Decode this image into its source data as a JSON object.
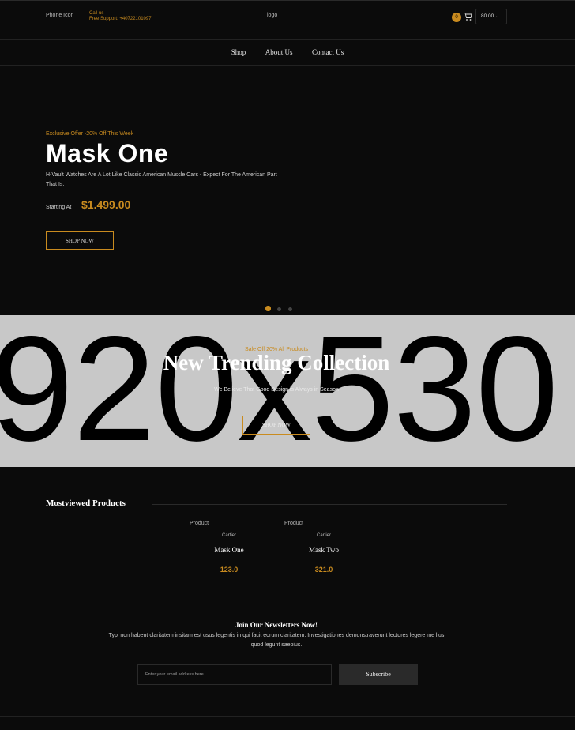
{
  "header": {
    "phone_icon_alt": "Phone Icon",
    "call_us": "Call us",
    "free_support": "Free Support: +40722101097",
    "logo_alt": "logo",
    "cart_count": "0",
    "cart_total": "80.00",
    "accent_color": "#c98b1f"
  },
  "nav": {
    "items": [
      {
        "label": "Shop"
      },
      {
        "label": "About Us"
      },
      {
        "label": "Contact Us"
      }
    ]
  },
  "hero": {
    "offer": "Exclusive Offer -20% Off This Week",
    "title": "Mask One",
    "description": "H-Vault Watches Are A Lot Like Classic American Muscle Cars - Expect For The American Part That Is.",
    "starting_label": "Starting At",
    "price": "$1.499.00",
    "button": "SHOP NOW",
    "slide_count": 3,
    "active_slide": 1
  },
  "banner": {
    "placeholder_text": "920x530",
    "sale": "Sale Off 20% All Products",
    "title": "New Trending Collection",
    "description": "We Believe That Good Design is Always in Season",
    "button": "SHOP NOW"
  },
  "products": {
    "title": "Mostviewed Products",
    "items": [
      {
        "image_alt": "Product",
        "brand": "Cartier",
        "name": "Mask One",
        "price": "123.0"
      },
      {
        "image_alt": "Product",
        "brand": "Cartier",
        "name": "Mask Two",
        "price": "321.0"
      }
    ]
  },
  "newsletter": {
    "title": "Join Our Newsletters Now!",
    "description": "Typi non habent claritatem insitam est usus legentis in qui facit eorum claritatem. Investigationes demonstraverunt lectores legere me lius quod legunt saepius.",
    "placeholder": "Enter your email address here..",
    "button": "Subscribe"
  }
}
